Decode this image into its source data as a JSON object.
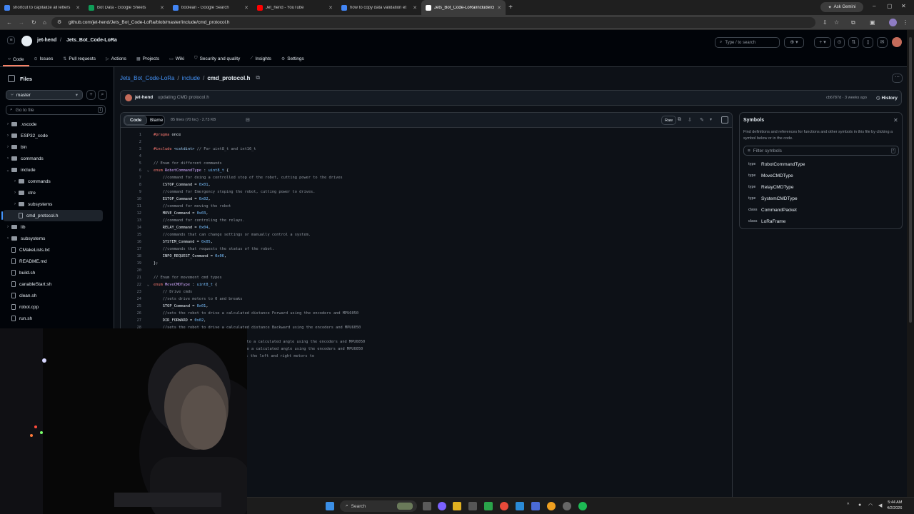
{
  "browser": {
    "tabs": [
      {
        "title": "shortcut to capitalize all letters",
        "color": "#4285f4"
      },
      {
        "title": "Bot Data - Google Sheets",
        "color": "#0f9d58"
      },
      {
        "title": "boolean - Google Search",
        "color": "#4285f4"
      },
      {
        "title": "Jet_hend - YouTube",
        "color": "#ff0000"
      },
      {
        "title": "how to copy data validation et",
        "color": "#4285f4"
      },
      {
        "title": "Jets_Bot_Code-LoRa/include/cm",
        "color": "#ffffff"
      }
    ],
    "ask_gemini": "Ask Gemini",
    "url": "github.com/jet-hend/Jets_Bot_Code-LoRa/blob/master/include/cmd_protocol.h"
  },
  "github": {
    "owner": "jet-hend",
    "repo": "Jets_Bot_Code-LoRa",
    "search_placeholder": "Type / to search",
    "nav": [
      "Code",
      "Issues",
      "Pull requests",
      "Actions",
      "Projects",
      "Wiki",
      "Security and quality",
      "Insights",
      "Settings"
    ]
  },
  "sidebar": {
    "title": "Files",
    "branch": "master",
    "goto_placeholder": "Go to file",
    "goto_key": "t",
    "tree": [
      {
        "name": ".vscode",
        "type": "folder",
        "depth": 0,
        "open": false
      },
      {
        "name": "ESP32_code",
        "type": "folder",
        "depth": 0,
        "open": false
      },
      {
        "name": "bin",
        "type": "folder",
        "depth": 0,
        "open": false
      },
      {
        "name": "commands",
        "type": "folder",
        "depth": 0,
        "open": false
      },
      {
        "name": "include",
        "type": "folder",
        "depth": 0,
        "open": true
      },
      {
        "name": "commands",
        "type": "folder",
        "depth": 1,
        "open": false
      },
      {
        "name": "ctre",
        "type": "folder",
        "depth": 1,
        "open": false
      },
      {
        "name": "subsystems",
        "type": "folder",
        "depth": 1,
        "open": false
      },
      {
        "name": "cmd_protocol.h",
        "type": "file",
        "depth": 1,
        "selected": true
      },
      {
        "name": "lib",
        "type": "folder",
        "depth": 0,
        "open": false
      },
      {
        "name": "subsystems",
        "type": "folder",
        "depth": 0,
        "open": false
      },
      {
        "name": "CMakeLists.txt",
        "type": "file",
        "depth": 0
      },
      {
        "name": "README.md",
        "type": "file",
        "depth": 0
      },
      {
        "name": "build.sh",
        "type": "file",
        "depth": 0
      },
      {
        "name": "canableStart.sh",
        "type": "file",
        "depth": 0
      },
      {
        "name": "clean.sh",
        "type": "file",
        "depth": 0
      },
      {
        "name": "robot.cpp",
        "type": "file",
        "depth": 0
      },
      {
        "name": "run.sh",
        "type": "file",
        "depth": 0
      }
    ]
  },
  "breadcrumb": {
    "repo": "Jets_Bot_Code-LoRa",
    "sep": "/",
    "folder": "include",
    "file": "cmd_protocol.h"
  },
  "commit": {
    "author": "jet-hend",
    "message": "updating CMD protocol.h",
    "hash": "cb6787d",
    "dot": "·",
    "age": "3 weeks ago",
    "history": "History"
  },
  "codeview": {
    "tab_code": "Code",
    "tab_blame": "Blame",
    "meta": "85 lines (70 loc) · 2.73 KB",
    "raw": "Raw",
    "lines": [
      {
        "n": "1",
        "t": "#pragma once"
      },
      {
        "n": "2",
        "t": ""
      },
      {
        "n": "3",
        "t": "#include <cstdint> // For uint8_t and int16_t"
      },
      {
        "n": "4",
        "t": ""
      },
      {
        "n": "5",
        "t": "// Enum for different commands"
      },
      {
        "n": "6",
        "t": "enum RobotCommandType : uint8_t {",
        "fold": true
      },
      {
        "n": "7",
        "t": "    //command for doing a controlled stop of the robot, cutting power to the drives"
      },
      {
        "n": "8",
        "t": "    CSTOP_Command = 0x01,"
      },
      {
        "n": "9",
        "t": "    //command for Emergency stoping the robot, cutting power to drives."
      },
      {
        "n": "10",
        "t": "    ESTOP_Command = 0x02,"
      },
      {
        "n": "11",
        "t": "    //command for moving the robot"
      },
      {
        "n": "12",
        "t": "    MOVE_Command = 0x03,"
      },
      {
        "n": "13",
        "t": "    //command for controling the relays."
      },
      {
        "n": "14",
        "t": "    RELAY_Command = 0x04,"
      },
      {
        "n": "15",
        "t": "    //commands that can change settings or manually control a system."
      },
      {
        "n": "16",
        "t": "    SYSTEM_Command = 0x05,"
      },
      {
        "n": "17",
        "t": "    //commands that requests the status of the robot."
      },
      {
        "n": "18",
        "t": "    INFO_REQUEST_Command = 0x06,"
      },
      {
        "n": "19",
        "t": "};"
      },
      {
        "n": "20",
        "t": ""
      },
      {
        "n": "21",
        "t": "// Enum for movement cmd types"
      },
      {
        "n": "22",
        "t": "enum MoveCMDType : uint8_t {",
        "fold": true
      },
      {
        "n": "23",
        "t": "    // Drive cmds"
      },
      {
        "n": "24",
        "t": "    //sets drive motors to 0 and breaks"
      },
      {
        "n": "25",
        "t": "    STOP_Command = 0x01,"
      },
      {
        "n": "26",
        "t": "    //sets the robot to drive a calculated distance Forward using the encoders and MPU6050"
      },
      {
        "n": "27",
        "t": "    DIR_FORWARD = 0x02,"
      },
      {
        "n": "28",
        "t": "    //sets the robot to drive a calculated distance Backward using the encoders and MPU6050"
      }
    ],
    "hidden_fragments": [
      "t to a calculated angle using the encoders and MPU6050",
      ": to a calculated angle using the encoders and MPU6050",
      "set the left and right motors to"
    ]
  },
  "symbols": {
    "title": "Symbols",
    "description": "Find definitions and references for functions and other symbols in this file by clicking a symbol below or in the code.",
    "filter_placeholder": "Filter symbols",
    "items": [
      {
        "kind": "type",
        "name": "RobotCommandType"
      },
      {
        "kind": "type",
        "name": "MoveCMDType"
      },
      {
        "kind": "type",
        "name": "RelayCMDType"
      },
      {
        "kind": "type",
        "name": "SystemCMDType"
      },
      {
        "kind": "class",
        "name": "CommandPacket"
      },
      {
        "kind": "class",
        "name": "LoRaFrame"
      }
    ]
  },
  "taskbar": {
    "search": "Search",
    "time": "5:44 AM",
    "date": "4/2/2026"
  },
  "colors": {
    "accent": "#4493f8",
    "selected_tab_underline": "#f78166",
    "bg": "#0d1117"
  }
}
